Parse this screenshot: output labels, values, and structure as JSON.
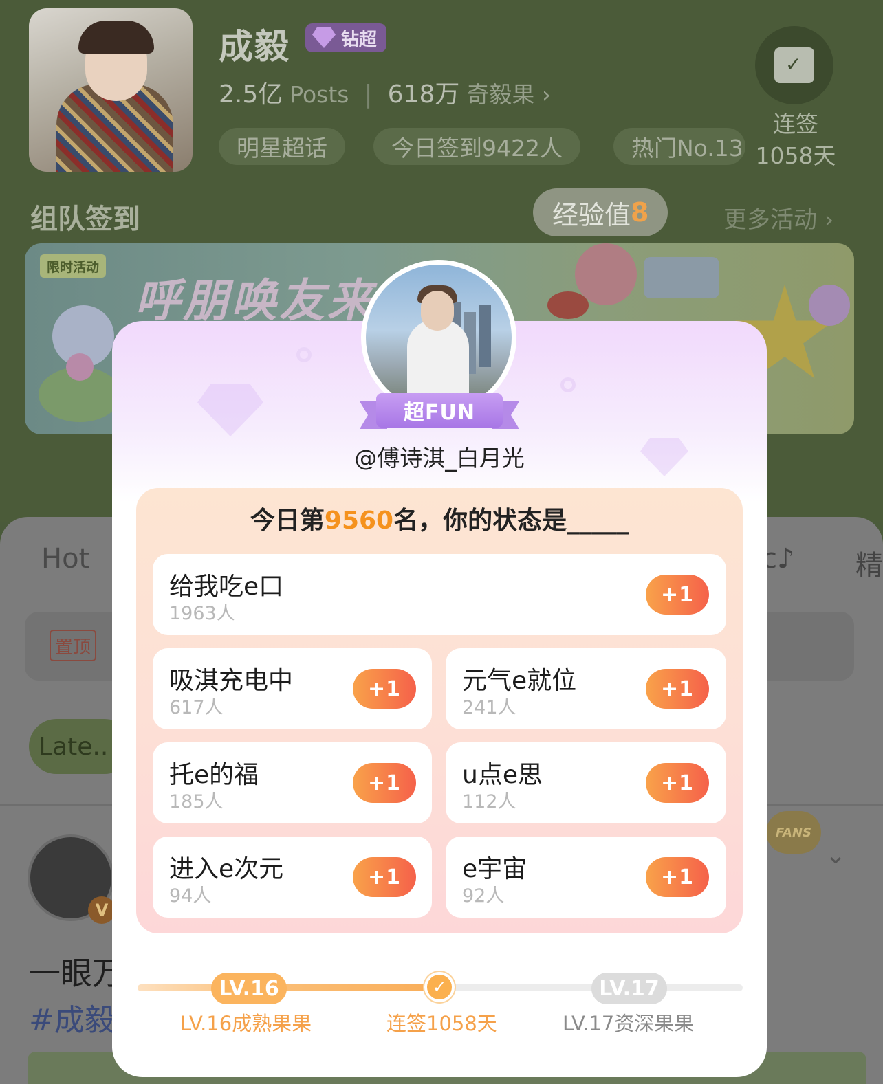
{
  "header": {
    "star_name": "成毅",
    "vip_label": "钻超",
    "posts_value": "2.5亿",
    "posts_label": "Posts",
    "fruits_value": "618万",
    "fruits_label": "奇毅果",
    "chips": [
      "明星超话",
      "今日签到9422人",
      "热门No.13"
    ],
    "checkin_title": "连签",
    "checkin_days": "1058天"
  },
  "team": {
    "title": "组队签到",
    "exp_label": "经验值",
    "exp_value": "8",
    "more": "更多活动 ›"
  },
  "banner": {
    "tag": "限时活动",
    "headline": "呼朋唤友来签"
  },
  "sheet": {
    "tab_hot": "Hot",
    "tab_right_a": "c♪",
    "tab_right_b": "精",
    "pinned_tag": "置顶",
    "latest_pill": "Late..",
    "poster_v": "V",
    "fans_badge": "FANS",
    "post_line1": "一眼万",
    "post_line2": "#成毅"
  },
  "popup": {
    "badge": "超FUN",
    "username": "@傅诗淇_白月光",
    "question_prefix": "今日第",
    "rank": "9560",
    "question_suffix": "名，你的状态是_____",
    "options": [
      {
        "label": "给我吃e口",
        "count": "1963人",
        "action": "+1"
      },
      {
        "label": "吸淇充电中",
        "count": "617人",
        "action": "+1"
      },
      {
        "label": "元气e就位",
        "count": "241人",
        "action": "+1"
      },
      {
        "label": "托e的福",
        "count": "185人",
        "action": "+1"
      },
      {
        "label": "u点e思",
        "count": "112人",
        "action": "+1"
      },
      {
        "label": "进入e次元",
        "count": "94人",
        "action": "+1"
      },
      {
        "label": "e宇宙",
        "count": "92人",
        "action": "+1"
      }
    ],
    "level": {
      "current_badge": "LV.16",
      "current_caption": "LV.16成熟果果",
      "streak_caption": "连签1058天",
      "next_badge": "LV.17",
      "next_caption": "LV.17资深果果",
      "progress": 0.5
    }
  },
  "colors": {
    "accent_orange": "#f5921e",
    "plus_button": "#f5614a",
    "fun_purple": "#a877e6"
  }
}
